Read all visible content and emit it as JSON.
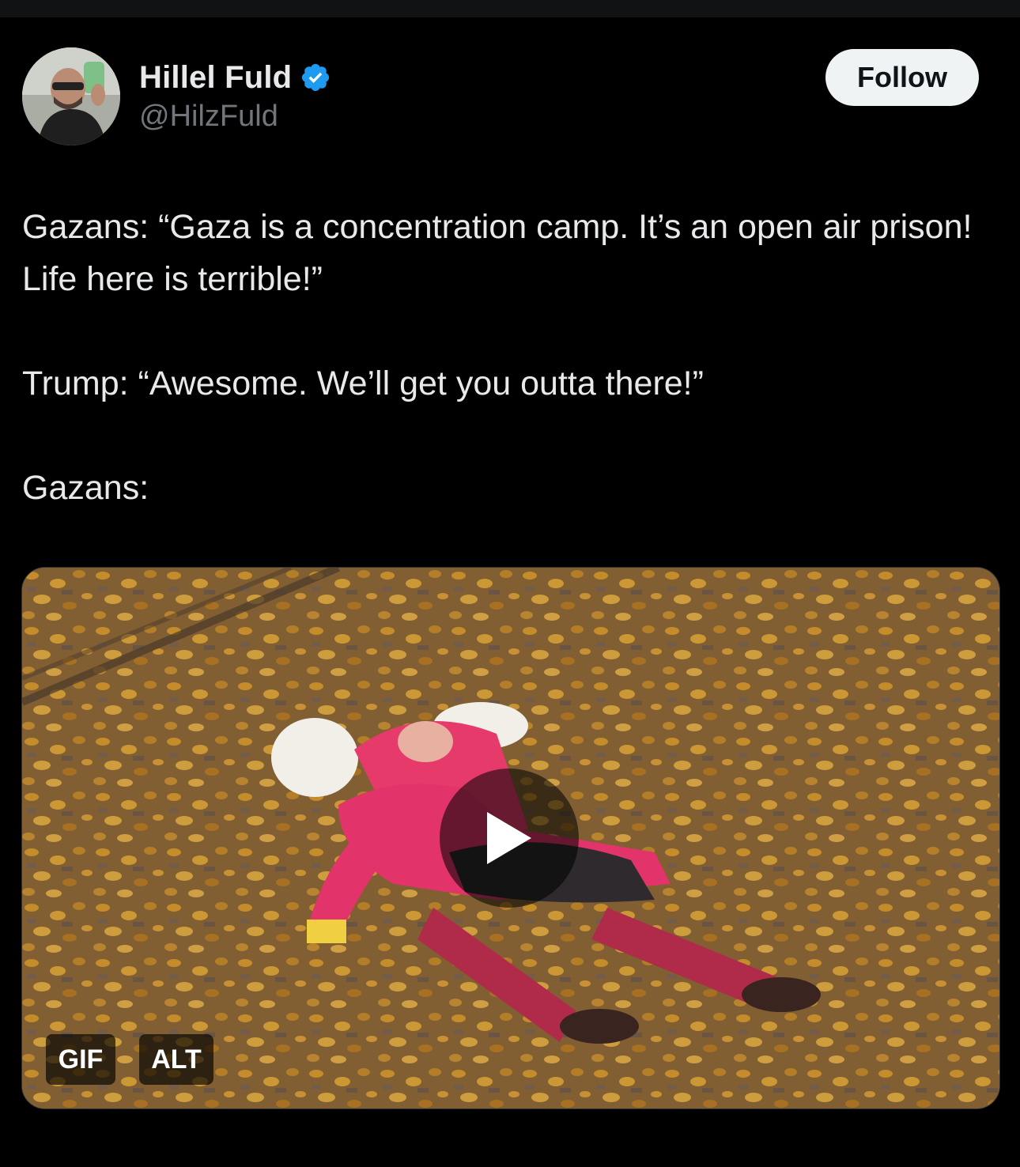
{
  "author": {
    "display_name": "Hillel Fuld",
    "handle": "@HilzFuld",
    "verified": true,
    "verified_color": "#1d9bf0"
  },
  "actions": {
    "follow_label": "Follow"
  },
  "tweet": {
    "paragraphs": [
      "Gazans: “Gaza is a concentration camp. It’s an open air prison! Life here is terrible!”",
      "Trump: “Awesome. We’ll get you outta there!”",
      "Gazans:"
    ]
  },
  "media": {
    "type_badge": "GIF",
    "alt_badge": "ALT",
    "play_icon": "play-icon"
  }
}
